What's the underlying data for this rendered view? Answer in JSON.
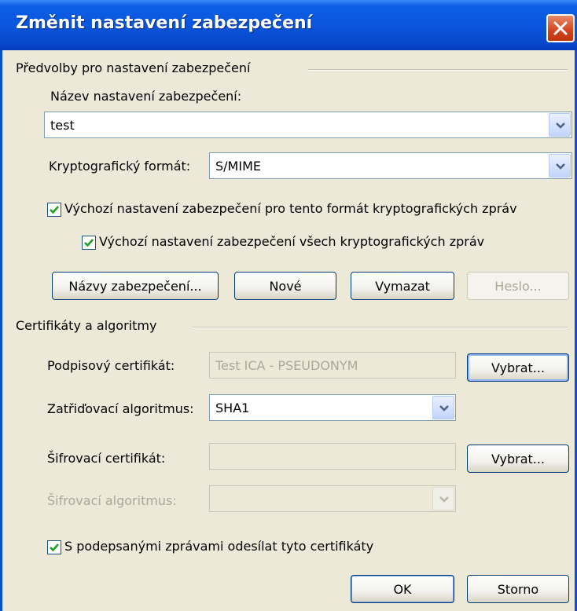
{
  "window": {
    "title": "Změnit nastavení zabezpečení",
    "close_icon": "close-icon"
  },
  "presets": {
    "group_label": "Předvolby pro nastavení zabezpečení",
    "name_label": "Název nastavení zabezpečení:",
    "name_value": "test",
    "format_label": "Kryptografický formát:",
    "format_value": "S/MIME",
    "default_format_check": {
      "label": "Výchozí nastavení zabezpečení pro tento formát kryptografických zpráv",
      "checked": true
    },
    "default_all_check": {
      "label": "Výchozí nastavení zabezpečení všech kryptografických zpráv",
      "checked": true
    },
    "buttons": {
      "names": "Názvy zabezpečení...",
      "new": "Nové",
      "delete": "Vymazat",
      "password": "Heslo..."
    }
  },
  "certs": {
    "group_label": "Certifikáty a algoritmy",
    "signing_label": "Podpisový certifikát:",
    "signing_value": "Test ICA - PSEUDONYM",
    "signing_choose": "Vybrat...",
    "hash_label": "Zatřiďovací algoritmus:",
    "hash_value": "SHA1",
    "encryption_label": "Šifrovací certifikát:",
    "encryption_value": "",
    "encryption_choose": "Vybrat...",
    "enc_alg_label": "Šifrovací algoritmus:",
    "enc_alg_value": "",
    "send_certs_check": {
      "label": "S podepsanými zprávami odesílat tyto certifikáty",
      "checked": true
    }
  },
  "footer": {
    "ok": "OK",
    "cancel": "Storno"
  },
  "colors": {
    "titlebar": "#0a56dc",
    "face": "#ece9d8",
    "close": "#d2431c",
    "check": "#21a121"
  }
}
